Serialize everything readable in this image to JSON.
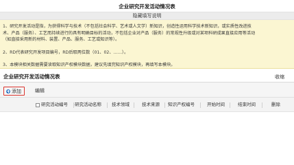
{
  "page": {
    "title": "企业研究开发活动情况表",
    "hint_label": "隐藏填写说明"
  },
  "notes": [
    "1、研究开发活动是指，为获得科学与技术（不包括社会科学、艺术或人文学）新知识，创造性运用科学技术新知识，或实质性改进技",
    "术、产品（服务）、工艺而持续进行的具有明确目标的活动，不包括企业对产品（服务）的常规性升级或对某项科研成果直接应用等活动",
    "（如直接采用新的材料、装置、产品、服务、工艺或知识等）。",
    "2、RD代表研究开发项目编号，RD后取两位数（01、02、……）。",
    "3、本模块相关数据需要读取知识产权模块数据，建议先填完知识产权模块，再填写本模块。"
  ],
  "section": {
    "title": "企业研究开发活动情况表",
    "collapse_label": "收缩"
  },
  "toolbar": {
    "add_label": "添加",
    "edit_label": "编辑"
  },
  "table": {
    "columns": [
      "研究活动编号",
      "研究活动名称",
      "技术领域",
      "技术来源",
      "知识产权编号",
      "开始时间",
      "结束时间",
      "删除"
    ]
  },
  "colors": {
    "notes_background": "#fbf6d2",
    "highlight_border": "#d9312b",
    "add_icon": "#2f77c4",
    "header_background": "#f3f3f3"
  }
}
